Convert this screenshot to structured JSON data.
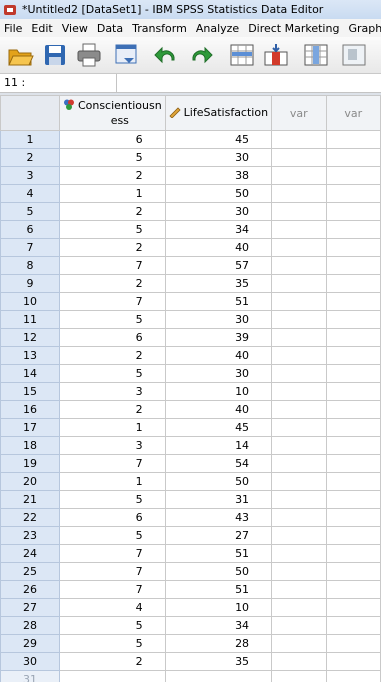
{
  "window": {
    "title": "*Untitled2 [DataSet1] - IBM SPSS Statistics Data Editor"
  },
  "menu": [
    "File",
    "Edit",
    "View",
    "Data",
    "Transform",
    "Analyze",
    "Direct Marketing",
    "Graphs"
  ],
  "toolbar": {
    "icons": [
      "open-icon",
      "save-icon",
      "print-icon",
      "dialog-recall-icon",
      "undo-icon",
      "redo-icon",
      "goto-case-icon",
      "goto-variable-icon",
      "variables-icon",
      "find-icon"
    ]
  },
  "cell_reference": "11 :",
  "columns": [
    {
      "name": "Conscientiousness",
      "header_line1": "Conscientiousn",
      "header_line2": "ess",
      "type_icon": "nominal-icon"
    },
    {
      "name": "LifeSatisfaction",
      "type_icon": "scale-icon"
    },
    {
      "name": "var"
    },
    {
      "name": "var"
    }
  ],
  "rows": [
    {
      "n": "1",
      "c": "6",
      "l": "45"
    },
    {
      "n": "2",
      "c": "5",
      "l": "30"
    },
    {
      "n": "3",
      "c": "2",
      "l": "38"
    },
    {
      "n": "4",
      "c": "1",
      "l": "50"
    },
    {
      "n": "5",
      "c": "2",
      "l": "30"
    },
    {
      "n": "6",
      "c": "5",
      "l": "34"
    },
    {
      "n": "7",
      "c": "2",
      "l": "40"
    },
    {
      "n": "8",
      "c": "7",
      "l": "57"
    },
    {
      "n": "9",
      "c": "2",
      "l": "35"
    },
    {
      "n": "10",
      "c": "7",
      "l": "51"
    },
    {
      "n": "11",
      "c": "5",
      "l": "30"
    },
    {
      "n": "12",
      "c": "6",
      "l": "39"
    },
    {
      "n": "13",
      "c": "2",
      "l": "40"
    },
    {
      "n": "14",
      "c": "5",
      "l": "30"
    },
    {
      "n": "15",
      "c": "3",
      "l": "10"
    },
    {
      "n": "16",
      "c": "2",
      "l": "40"
    },
    {
      "n": "17",
      "c": "1",
      "l": "45"
    },
    {
      "n": "18",
      "c": "3",
      "l": "14"
    },
    {
      "n": "19",
      "c": "7",
      "l": "54"
    },
    {
      "n": "20",
      "c": "1",
      "l": "50"
    },
    {
      "n": "21",
      "c": "5",
      "l": "31"
    },
    {
      "n": "22",
      "c": "6",
      "l": "43"
    },
    {
      "n": "23",
      "c": "5",
      "l": "27"
    },
    {
      "n": "24",
      "c": "7",
      "l": "51"
    },
    {
      "n": "25",
      "c": "7",
      "l": "50"
    },
    {
      "n": "26",
      "c": "7",
      "l": "51"
    },
    {
      "n": "27",
      "c": "4",
      "l": "10"
    },
    {
      "n": "28",
      "c": "5",
      "l": "34"
    },
    {
      "n": "29",
      "c": "5",
      "l": "28"
    },
    {
      "n": "30",
      "c": "2",
      "l": "35"
    },
    {
      "n": "31",
      "c": "",
      "l": ""
    }
  ]
}
